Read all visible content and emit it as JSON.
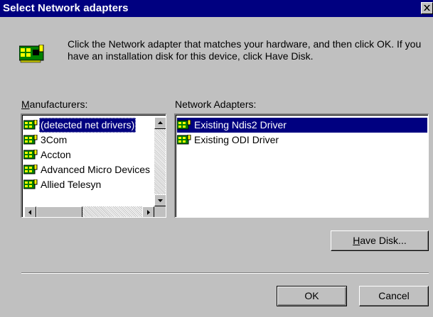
{
  "window": {
    "title": "Select Network adapters",
    "close_icon": "close-x-icon"
  },
  "header": {
    "icon": "network-adapter-icon",
    "instruction": "Click the Network adapter that matches your hardware, and then click OK. If you have an installation disk for this device, click Have Disk."
  },
  "manufacturers": {
    "label_underline": "M",
    "label_rest": "anufacturers:",
    "items": [
      {
        "label": "(detected net drivers)",
        "selected": true
      },
      {
        "label": "3Com",
        "selected": false
      },
      {
        "label": "Accton",
        "selected": false
      },
      {
        "label": "Advanced Micro Devices",
        "selected": false
      },
      {
        "label": "Allied Telesyn",
        "selected": false
      }
    ]
  },
  "adapters": {
    "label": "Network Adapters:",
    "items": [
      {
        "label": "Existing Ndis2 Driver",
        "selected": true
      },
      {
        "label": "Existing ODI Driver",
        "selected": false
      }
    ]
  },
  "buttons": {
    "have_disk_underline": "H",
    "have_disk_rest": "ave Disk...",
    "ok": "OK",
    "cancel": "Cancel"
  },
  "colors": {
    "titlebar": "#000080",
    "face": "#c0c0c0",
    "selection": "#000080"
  }
}
